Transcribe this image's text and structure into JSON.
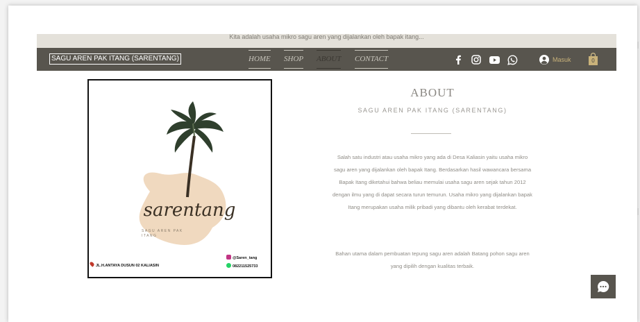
{
  "promo_banner": {
    "text": "Kita adalah usaha mikro sagu aren yang dijalankan oleh bapak itang..."
  },
  "header": {
    "site_title": "SAGU AREN PAK ITANG (SARENTANG)",
    "nav": [
      {
        "label": "HOME"
      },
      {
        "label": "SHOP"
      },
      {
        "label": "ABOUT",
        "active": true
      },
      {
        "label": "CONTACT"
      }
    ],
    "social_icons": [
      "facebook-icon",
      "instagram-icon",
      "youtube-icon",
      "whatsapp-icon"
    ],
    "login_label": "Masuk",
    "cart_count": "0"
  },
  "poster": {
    "brand_script": "sarentang",
    "brand_sub": "SAGU AREN PAK ITANG",
    "address": "JL.H.ANTAYA DUSUN 02 KALIASIN",
    "instagram": "@Saren_tang",
    "phone": "082211525733"
  },
  "about": {
    "title": "ABOUT",
    "subtitle": "SAGU AREN PAK ITANG (SARENTANG)",
    "paragraph1": "Salah satu industri atau usaha mikro yang ada di Desa Kaliasin yaitu usaha mikro sagu aren yang dijalankan oleh bapak Itang. Berdasarkan hasil wawancara bersama Bapak Itang diketahui bahwa beliau memulai usaha sagu aren sejak tahun 2012 dengan ilmu yang di dapat secara turun temurun. Usaha mikro yang dijalankan bapak Itang merupakan usaha milik pribadi yang dibantu oleh kerabat terdekat.",
    "paragraph2": "Bahan utama dalam pembuatan tepung sagu aren adalah Batang pohon sagu aren yang dipilih dengan kualitas terbaik."
  },
  "colors": {
    "navbar": "#58554e",
    "accent_gold": "#c9b27a",
    "poster_blob": "#f0d9bf"
  }
}
